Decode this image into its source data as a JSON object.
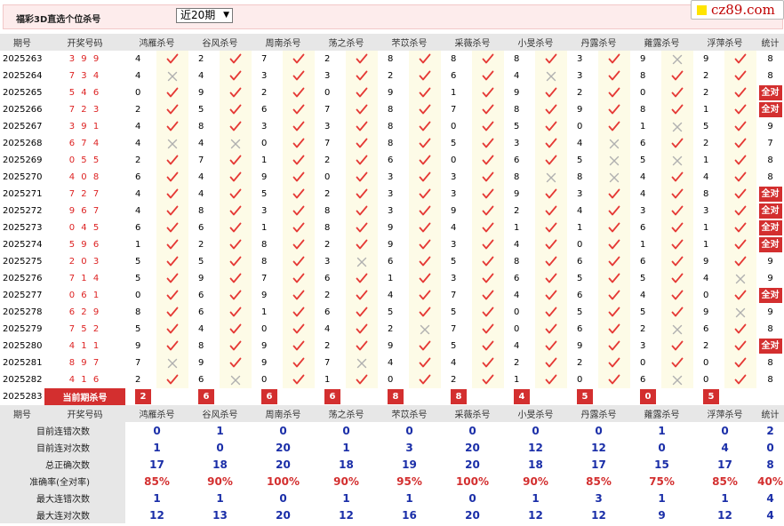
{
  "page": {
    "title": "福彩3D直选个位杀号",
    "period_select": "近20期",
    "logo": "cz89.com"
  },
  "columns": [
    "期号",
    "开奖号码",
    "鸿雁杀号",
    "谷风杀号",
    "周南杀号",
    "荡之杀号",
    "芣苡杀号",
    "采薇杀号",
    "小旻杀号",
    "丹露杀号",
    "蕹露杀号",
    "浮萍杀号",
    "统计"
  ],
  "rows": [
    {
      "period": "2025263",
      "draw": "3 9 9",
      "kills": [
        [
          "4",
          "y"
        ],
        [
          "2",
          "y"
        ],
        [
          "7",
          "y"
        ],
        [
          "2",
          "y"
        ],
        [
          "8",
          "y"
        ],
        [
          "8",
          "y"
        ],
        [
          "8",
          "y"
        ],
        [
          "3",
          "y"
        ],
        [
          "9",
          "n"
        ],
        [
          "9",
          "y"
        ]
      ],
      "total": "8"
    },
    {
      "period": "2025264",
      "draw": "7 3 4",
      "kills": [
        [
          "4",
          "n"
        ],
        [
          "4",
          "y"
        ],
        [
          "3",
          "y"
        ],
        [
          "3",
          "y"
        ],
        [
          "2",
          "y"
        ],
        [
          "6",
          "y"
        ],
        [
          "4",
          "n"
        ],
        [
          "3",
          "y"
        ],
        [
          "8",
          "y"
        ],
        [
          "2",
          "y"
        ]
      ],
      "total": "8"
    },
    {
      "period": "2025265",
      "draw": "5 4 6",
      "kills": [
        [
          "0",
          "y"
        ],
        [
          "9",
          "y"
        ],
        [
          "2",
          "y"
        ],
        [
          "0",
          "y"
        ],
        [
          "9",
          "y"
        ],
        [
          "1",
          "y"
        ],
        [
          "9",
          "y"
        ],
        [
          "2",
          "y"
        ],
        [
          "0",
          "y"
        ],
        [
          "2",
          "y"
        ]
      ],
      "total": "全对"
    },
    {
      "period": "2025266",
      "draw": "7 2 3",
      "kills": [
        [
          "2",
          "y"
        ],
        [
          "5",
          "y"
        ],
        [
          "6",
          "y"
        ],
        [
          "7",
          "y"
        ],
        [
          "8",
          "y"
        ],
        [
          "7",
          "y"
        ],
        [
          "8",
          "y"
        ],
        [
          "9",
          "y"
        ],
        [
          "8",
          "y"
        ],
        [
          "1",
          "y"
        ]
      ],
      "total": "全对"
    },
    {
      "period": "2025267",
      "draw": "3 9 1",
      "kills": [
        [
          "4",
          "y"
        ],
        [
          "8",
          "y"
        ],
        [
          "3",
          "y"
        ],
        [
          "3",
          "y"
        ],
        [
          "8",
          "y"
        ],
        [
          "0",
          "y"
        ],
        [
          "5",
          "y"
        ],
        [
          "0",
          "y"
        ],
        [
          "1",
          "n"
        ],
        [
          "5",
          "y"
        ]
      ],
      "total": "9"
    },
    {
      "period": "2025268",
      "draw": "6 7 4",
      "kills": [
        [
          "4",
          "n"
        ],
        [
          "4",
          "n"
        ],
        [
          "0",
          "y"
        ],
        [
          "7",
          "y"
        ],
        [
          "8",
          "y"
        ],
        [
          "5",
          "y"
        ],
        [
          "3",
          "y"
        ],
        [
          "4",
          "n"
        ],
        [
          "6",
          "y"
        ],
        [
          "2",
          "y"
        ]
      ],
      "total": "7"
    },
    {
      "period": "2025269",
      "draw": "0 5 5",
      "kills": [
        [
          "2",
          "y"
        ],
        [
          "7",
          "y"
        ],
        [
          "1",
          "y"
        ],
        [
          "2",
          "y"
        ],
        [
          "6",
          "y"
        ],
        [
          "0",
          "y"
        ],
        [
          "6",
          "y"
        ],
        [
          "5",
          "n"
        ],
        [
          "5",
          "n"
        ],
        [
          "1",
          "y"
        ]
      ],
      "total": "8"
    },
    {
      "period": "2025270",
      "draw": "4 0 8",
      "kills": [
        [
          "6",
          "y"
        ],
        [
          "4",
          "y"
        ],
        [
          "9",
          "y"
        ],
        [
          "0",
          "y"
        ],
        [
          "3",
          "y"
        ],
        [
          "3",
          "y"
        ],
        [
          "8",
          "n"
        ],
        [
          "8",
          "n"
        ],
        [
          "4",
          "y"
        ],
        [
          "4",
          "y"
        ]
      ],
      "total": "8"
    },
    {
      "period": "2025271",
      "draw": "7 2 7",
      "kills": [
        [
          "4",
          "y"
        ],
        [
          "4",
          "y"
        ],
        [
          "5",
          "y"
        ],
        [
          "2",
          "y"
        ],
        [
          "3",
          "y"
        ],
        [
          "3",
          "y"
        ],
        [
          "9",
          "y"
        ],
        [
          "3",
          "y"
        ],
        [
          "4",
          "y"
        ],
        [
          "8",
          "y"
        ]
      ],
      "total": "全对"
    },
    {
      "period": "2025272",
      "draw": "9 6 7",
      "kills": [
        [
          "4",
          "y"
        ],
        [
          "8",
          "y"
        ],
        [
          "3",
          "y"
        ],
        [
          "8",
          "y"
        ],
        [
          "3",
          "y"
        ],
        [
          "9",
          "y"
        ],
        [
          "2",
          "y"
        ],
        [
          "4",
          "y"
        ],
        [
          "3",
          "y"
        ],
        [
          "3",
          "y"
        ]
      ],
      "total": "全对"
    },
    {
      "period": "2025273",
      "draw": "0 4 5",
      "kills": [
        [
          "6",
          "y"
        ],
        [
          "6",
          "y"
        ],
        [
          "1",
          "y"
        ],
        [
          "8",
          "y"
        ],
        [
          "9",
          "y"
        ],
        [
          "4",
          "y"
        ],
        [
          "1",
          "y"
        ],
        [
          "1",
          "y"
        ],
        [
          "6",
          "y"
        ],
        [
          "1",
          "y"
        ]
      ],
      "total": "全对"
    },
    {
      "period": "2025274",
      "draw": "5 9 6",
      "kills": [
        [
          "1",
          "y"
        ],
        [
          "2",
          "y"
        ],
        [
          "8",
          "y"
        ],
        [
          "2",
          "y"
        ],
        [
          "9",
          "y"
        ],
        [
          "3",
          "y"
        ],
        [
          "4",
          "y"
        ],
        [
          "0",
          "y"
        ],
        [
          "1",
          "y"
        ],
        [
          "1",
          "y"
        ]
      ],
      "total": "全对"
    },
    {
      "period": "2025275",
      "draw": "2 0 3",
      "kills": [
        [
          "5",
          "y"
        ],
        [
          "5",
          "y"
        ],
        [
          "8",
          "y"
        ],
        [
          "3",
          "n"
        ],
        [
          "6",
          "y"
        ],
        [
          "5",
          "y"
        ],
        [
          "8",
          "y"
        ],
        [
          "6",
          "y"
        ],
        [
          "6",
          "y"
        ],
        [
          "9",
          "y"
        ]
      ],
      "total": "9"
    },
    {
      "period": "2025276",
      "draw": "7 1 4",
      "kills": [
        [
          "5",
          "y"
        ],
        [
          "9",
          "y"
        ],
        [
          "7",
          "y"
        ],
        [
          "6",
          "y"
        ],
        [
          "1",
          "y"
        ],
        [
          "3",
          "y"
        ],
        [
          "6",
          "y"
        ],
        [
          "5",
          "y"
        ],
        [
          "5",
          "y"
        ],
        [
          "4",
          "n"
        ]
      ],
      "total": "9"
    },
    {
      "period": "2025277",
      "draw": "0 6 1",
      "kills": [
        [
          "0",
          "y"
        ],
        [
          "6",
          "y"
        ],
        [
          "9",
          "y"
        ],
        [
          "2",
          "y"
        ],
        [
          "4",
          "y"
        ],
        [
          "7",
          "y"
        ],
        [
          "4",
          "y"
        ],
        [
          "6",
          "y"
        ],
        [
          "4",
          "y"
        ],
        [
          "0",
          "y"
        ]
      ],
      "total": "全对"
    },
    {
      "period": "2025278",
      "draw": "6 2 9",
      "kills": [
        [
          "8",
          "y"
        ],
        [
          "6",
          "y"
        ],
        [
          "1",
          "y"
        ],
        [
          "6",
          "y"
        ],
        [
          "5",
          "y"
        ],
        [
          "5",
          "y"
        ],
        [
          "0",
          "y"
        ],
        [
          "5",
          "y"
        ],
        [
          "5",
          "y"
        ],
        [
          "9",
          "n"
        ]
      ],
      "total": "9"
    },
    {
      "period": "2025279",
      "draw": "7 5 2",
      "kills": [
        [
          "5",
          "y"
        ],
        [
          "4",
          "y"
        ],
        [
          "0",
          "y"
        ],
        [
          "4",
          "y"
        ],
        [
          "2",
          "n"
        ],
        [
          "7",
          "y"
        ],
        [
          "0",
          "y"
        ],
        [
          "6",
          "y"
        ],
        [
          "2",
          "n"
        ],
        [
          "6",
          "y"
        ]
      ],
      "total": "8"
    },
    {
      "period": "2025280",
      "draw": "4 1 1",
      "kills": [
        [
          "9",
          "y"
        ],
        [
          "8",
          "y"
        ],
        [
          "9",
          "y"
        ],
        [
          "2",
          "y"
        ],
        [
          "9",
          "y"
        ],
        [
          "5",
          "y"
        ],
        [
          "4",
          "y"
        ],
        [
          "9",
          "y"
        ],
        [
          "3",
          "y"
        ],
        [
          "2",
          "y"
        ]
      ],
      "total": "全对"
    },
    {
      "period": "2025281",
      "draw": "8 9 7",
      "kills": [
        [
          "7",
          "n"
        ],
        [
          "9",
          "y"
        ],
        [
          "9",
          "y"
        ],
        [
          "7",
          "n"
        ],
        [
          "4",
          "y"
        ],
        [
          "4",
          "y"
        ],
        [
          "2",
          "y"
        ],
        [
          "2",
          "y"
        ],
        [
          "0",
          "y"
        ],
        [
          "0",
          "y"
        ]
      ],
      "total": "8"
    },
    {
      "period": "2025282",
      "draw": "4 1 6",
      "kills": [
        [
          "2",
          "y"
        ],
        [
          "6",
          "n"
        ],
        [
          "0",
          "y"
        ],
        [
          "1",
          "y"
        ],
        [
          "0",
          "y"
        ],
        [
          "2",
          "y"
        ],
        [
          "1",
          "y"
        ],
        [
          "0",
          "y"
        ],
        [
          "6",
          "n"
        ],
        [
          "0",
          "y"
        ]
      ],
      "total": "8"
    }
  ],
  "current": {
    "period": "2025283",
    "label": "当前期杀号",
    "values": [
      "2",
      "6",
      "6",
      "6",
      "8",
      "8",
      "4",
      "5",
      "0",
      "5"
    ]
  },
  "stats": [
    {
      "label": "目前连错次数",
      "values": [
        "0",
        "1",
        "0",
        "0",
        "0",
        "0",
        "0",
        "0",
        "1",
        "0",
        "2"
      ]
    },
    {
      "label": "目前连对次数",
      "values": [
        "1",
        "0",
        "20",
        "1",
        "3",
        "20",
        "12",
        "12",
        "0",
        "4",
        "0"
      ]
    },
    {
      "label": "总正确次数",
      "values": [
        "17",
        "18",
        "20",
        "18",
        "19",
        "20",
        "18",
        "17",
        "15",
        "17",
        "8"
      ]
    },
    {
      "label": "准确率(全对率)",
      "values": [
        "85%",
        "90%",
        "100%",
        "90%",
        "95%",
        "100%",
        "90%",
        "85%",
        "75%",
        "85%",
        "40%"
      ],
      "pct": true
    },
    {
      "label": "最大连错次数",
      "values": [
        "1",
        "1",
        "0",
        "1",
        "1",
        "0",
        "1",
        "3",
        "1",
        "1",
        "4"
      ]
    },
    {
      "label": "最大连对次数",
      "values": [
        "12",
        "13",
        "20",
        "12",
        "16",
        "20",
        "12",
        "12",
        "9",
        "12",
        "4"
      ]
    }
  ],
  "colors": {
    "accent": "#d32f2f",
    "check": "#e53935",
    "cross": "#b0b0b0",
    "stat": "#1a2ea8",
    "header": "#e7e7e7"
  }
}
